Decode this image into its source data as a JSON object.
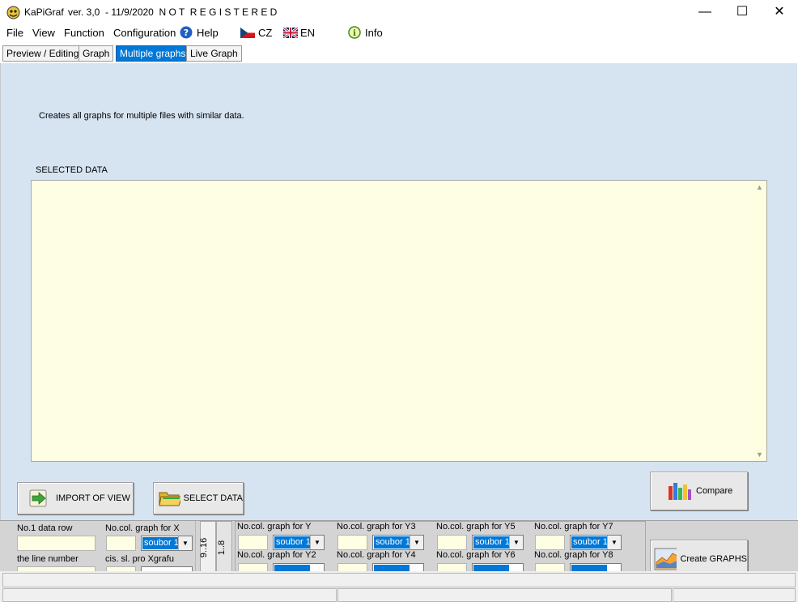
{
  "window": {
    "app_name": "KaPiGraf",
    "title_rest": "ver. 3,0  - 11/9/2020  N O T  R E G I S T E R E D",
    "minimize": "—",
    "maximize": "☐",
    "close": "✕"
  },
  "menu": {
    "file": "File",
    "view": "View",
    "function": "Function",
    "configuration": "Configuration",
    "help": "Help",
    "cz": "CZ",
    "en": "EN",
    "info": "Info"
  },
  "tabs": [
    {
      "label": "Preview / Editing"
    },
    {
      "label": "Graph"
    },
    {
      "label": "Multiple graphs"
    },
    {
      "label": "Live Graph"
    }
  ],
  "main": {
    "description": "Creates all graphs for multiple files with similar data.",
    "selected_data_label": "SELECTED DATA",
    "import_button": "IMPORT OF VIEW",
    "select_data_button": "SELECT DATA",
    "compare_button": "Compare",
    "create_graphs_button": "Create GRAPHS"
  },
  "config": {
    "data_row_label": "No.1 data row",
    "line_number_label": "the line number",
    "col_x_label": "No.col. graph for X",
    "cis_label": "cis. sl. pro Xgrafu",
    "combo_value": "soubor 1",
    "vert_1": "9..16",
    "vert_2": "1..8",
    "y_labels": {
      "y": "No.col. graph for Y",
      "y2": "No.col. graph for Y2",
      "y3": "No.col. graph for Y3",
      "y4": "No.col. graph for Y4",
      "y5": "No.col. graph for Y5",
      "y6": "No.col. graph for Y6",
      "y7": "No.col. graph for Y7",
      "y8": "No.col. graph for Y8"
    }
  },
  "colors": {
    "accent": "#0078d7",
    "panel_bg": "#d6e4f2",
    "data_bg": "#fefee4"
  }
}
